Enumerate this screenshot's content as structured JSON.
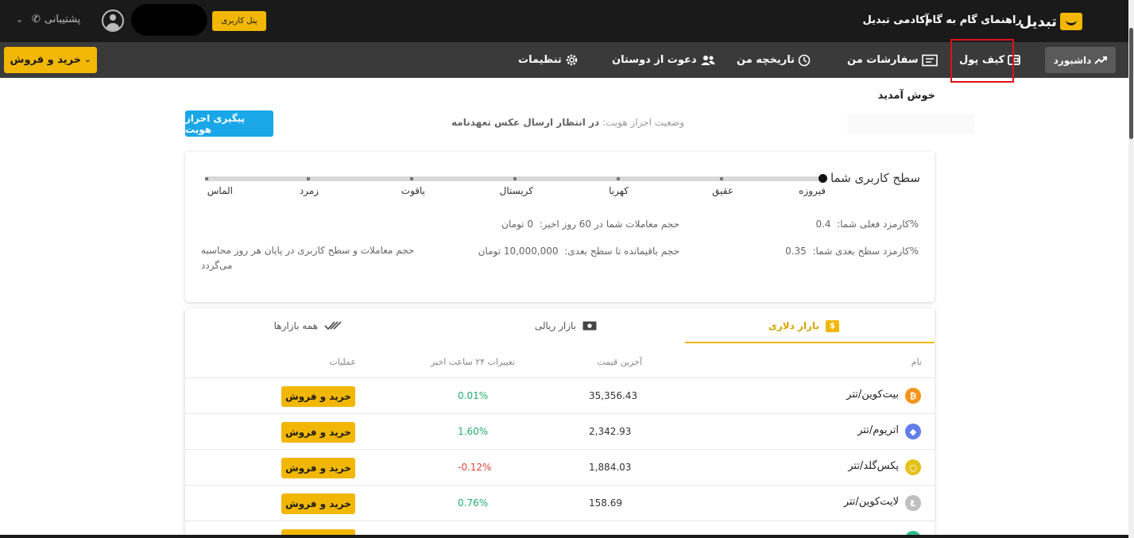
{
  "topbar": {
    "brand": "تبدیل",
    "links": [
      "راهنمای گام به گام",
      "آکادمی تبدیل"
    ],
    "panel_button": "پنل کاربری",
    "support": "پشتیبانی"
  },
  "navbar": {
    "dashboard": "داشبورد",
    "wallet": "کیف پول",
    "orders": "سفارشات من",
    "history": "تاریخچه من",
    "invite": "دعوت از دوستان",
    "settings": "تنظیمات",
    "buy_sell": "خرید و فروش"
  },
  "welcome": {
    "greeting": "خوش آمدید",
    "status_label": "وضعیت احراز هویت:",
    "status_value": "در انتظار ارسال عکس تعهدنامه",
    "verify_button": "پیگیری احراز هویت"
  },
  "level": {
    "title": "سطح کاربری شما",
    "tiers": [
      "فیروزه",
      "عقیق",
      "کهربا",
      "کریستال",
      "یاقوت",
      "زمرد",
      "الماس"
    ],
    "fee_current_label": "کارمزد فعلی شما:",
    "fee_current_value": "0.4%",
    "fee_next_label": "کارمزد سطح بعدی شما:",
    "fee_next_value": "0.35%",
    "volume_label": "حجم معاملات شما در 60 روز اخیر:",
    "volume_value": "0 تومان",
    "remaining_label": "حجم باقیمانده تا سطح بعدی:",
    "remaining_value": "10,000,000 تومان",
    "note": "حجم معاملات و سطح کاربری در پایان هر روز محاسبه می‌گردد"
  },
  "market": {
    "tabs": {
      "dollar": "بازار دلاری",
      "rial": "بازار ریالی",
      "all": "همه بازارها"
    },
    "headers": {
      "name": "نام",
      "price": "آخرین قیمت",
      "change": "تغییرات ۲۴ ساعت اخیر",
      "actions": "عملیات"
    },
    "rows": [
      {
        "name": "بیت‌کوین/تتر",
        "price": "35,356.43",
        "change": "0.01%",
        "icon": "bitcoin-icon",
        "color": "#f7931a",
        "glyph": "₿",
        "change_color": "#1fae6a"
      },
      {
        "name": "اتریوم/تتر",
        "price": "2,342.93",
        "change": "1.60%",
        "icon": "ethereum-icon",
        "color": "#627eea",
        "glyph": "◆",
        "change_color": "#1fae6a"
      },
      {
        "name": "پکس‌گلد/تتر",
        "price": "1,884.03",
        "change": "-0.12%",
        "icon": "paxgold-icon",
        "color": "#e4c21c",
        "glyph": "○",
        "change_color": "#e0453a"
      },
      {
        "name": "لایت‌کوین/تتر",
        "price": "158.69",
        "change": "0.76%",
        "icon": "litecoin-icon",
        "color": "#bfbfbf",
        "glyph": "Ł",
        "change_color": "#1fae6a"
      },
      {
        "name": "",
        "price": "",
        "change": "",
        "icon": "coin-icon",
        "color": "#2ebd85",
        "glyph": "",
        "change_color": "#1fae6a"
      }
    ],
    "trade_button": "خرید و فروش"
  }
}
